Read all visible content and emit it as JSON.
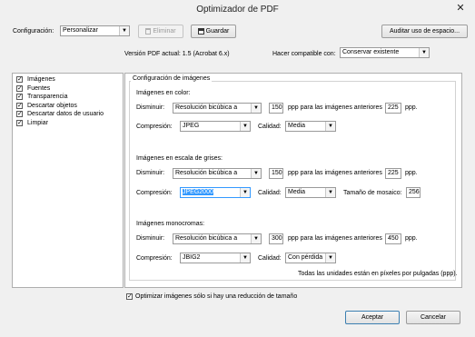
{
  "window": {
    "title": "Optimizador de PDF",
    "close_glyph": "✕"
  },
  "toolbar": {
    "config_label": "Configuración:",
    "config_value": "Personalizar",
    "delete_label": "Eliminar",
    "save_label": "Guardar",
    "audit_label": "Auditar uso de espacio..."
  },
  "version": {
    "text": "Versión PDF actual: 1.5 (Acrobat 6.x)",
    "compat_label": "Hacer compatible con:",
    "compat_value": "Conservar existente"
  },
  "sidebar": {
    "items": [
      {
        "label": "Imágenes",
        "checked": true
      },
      {
        "label": "Fuentes",
        "checked": true
      },
      {
        "label": "Transparencia",
        "checked": true
      },
      {
        "label": "Descartar objetos",
        "checked": true
      },
      {
        "label": "Descartar datos de usuario",
        "checked": true
      },
      {
        "label": "Limpiar",
        "checked": true
      }
    ]
  },
  "images": {
    "group_title": "Configuración de imágenes",
    "color": {
      "title": "Imágenes en color:",
      "down_label": "Disminuir:",
      "down_value": "Resolución bicúbica a",
      "ppi": "150",
      "for_text": "ppp para las imágenes anteriores",
      "above": "225",
      "unit": "ppp.",
      "comp_label": "Compresión:",
      "comp_value": "JPEG",
      "quality_label": "Calidad:",
      "quality_value": "Media"
    },
    "gray": {
      "title": "Imágenes en escala de grises:",
      "down_label": "Disminuir:",
      "down_value": "Resolución bicúbica a",
      "ppi": "150",
      "for_text": "ppp para las imágenes anteriores",
      "above": "225",
      "unit": "ppp.",
      "comp_label": "Compresión:",
      "comp_value": "JPEG2000",
      "quality_label": "Calidad:",
      "quality_value": "Media",
      "tile_label": "Tamaño de mosaico:",
      "tile_value": "256"
    },
    "mono": {
      "title": "Imágenes monocromas:",
      "down_label": "Disminuir:",
      "down_value": "Resolución bicúbica a",
      "ppi": "300",
      "for_text": "ppp para las imágenes anteriores",
      "above": "450",
      "unit": "ppp.",
      "comp_label": "Compresión:",
      "comp_value": "JBIG2",
      "quality_label": "Calidad:",
      "quality_value": "Con pérdida"
    },
    "note": "Todas las unidades están en píxeles por pulgadas (ppp)."
  },
  "optimize_check": {
    "label": "Optimizar imágenes sólo si hay una reducción de tamaño",
    "checked": true
  },
  "footer": {
    "ok_label": "Aceptar",
    "cancel_label": "Cancelar"
  },
  "icons": {
    "delete": "trash-icon",
    "save": "floppy-disk-icon",
    "dropdown": "chevron-down-icon",
    "check": "checkmark-icon"
  }
}
